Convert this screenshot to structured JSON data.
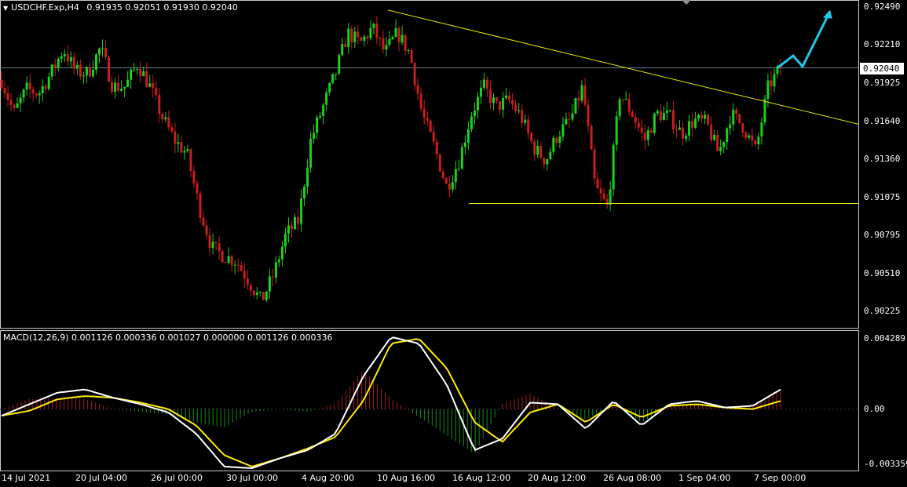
{
  "header": {
    "symbol_label": "USDCHF.Exp,H4",
    "ohlc": "0.91935 0.92051 0.91930 0.92040"
  },
  "macd": {
    "label": "MACD(12,26,9) 0.001126 0.000336 0.001027 0.000000 0.001126 0.000336",
    "ticks": [
      "0.004289",
      "0.00",
      "-0.003359"
    ]
  },
  "price_axis": {
    "ticks": [
      "0.92490",
      "0.92210",
      "0.91925",
      "0.91640",
      "0.91360",
      "0.91075",
      "0.90795",
      "0.90510",
      "0.90225"
    ],
    "current": "0.92040"
  },
  "time_axis": {
    "ticks": [
      "14 Jul 2021",
      "20 Jul 04:00",
      "26 Jul 00:00",
      "30 Jul 00:00",
      "4 Aug 20:00",
      "10 Aug 16:00",
      "16 Aug 12:00",
      "20 Aug 12:00",
      "26 Aug 08:00",
      "1 Sep 04:00",
      "7 Sep 00:00"
    ]
  },
  "colors": {
    "bull": "#1bd11b",
    "bear": "#c81e1e",
    "trendline": "#e6e600",
    "macd_line": "#ffffff",
    "signal_line": "#ffee00",
    "arrow": "#1ec8e6",
    "grid_line": "#6e7e8c"
  },
  "chart_data": {
    "type": "candlestick",
    "symbol": "USDCHF.Exp",
    "timeframe": "H4",
    "ylim": [
      0.9014,
      0.9251
    ],
    "current_price": 0.9204,
    "waypoints": [
      0.9195,
      0.917,
      0.9188,
      0.9185,
      0.92,
      0.9218,
      0.9201,
      0.92,
      0.9219,
      0.919,
      0.919,
      0.9207,
      0.919,
      0.9167,
      0.915,
      0.914,
      0.91,
      0.907,
      0.9064,
      0.906,
      0.9045,
      0.903,
      0.905,
      0.908,
      0.909,
      0.915,
      0.9175,
      0.92,
      0.923,
      0.9222,
      0.9234,
      0.9215,
      0.923,
      0.9215,
      0.917,
      0.9145,
      0.9115,
      0.9135,
      0.917,
      0.919,
      0.9175,
      0.918,
      0.9168,
      0.9145,
      0.9135,
      0.9155,
      0.9165,
      0.919,
      0.9115,
      0.91,
      0.9185,
      0.917,
      0.915,
      0.917,
      0.9168,
      0.9155,
      0.9165,
      0.9163,
      0.914,
      0.917,
      0.916,
      0.9142,
      0.919,
      0.9204
    ],
    "trendline_upper": {
      "from": {
        "x": "10 Aug 16:00",
        "y": 0.9247
      },
      "to": {
        "x": "end",
        "y": 0.9162
      }
    },
    "trendline_lower": {
      "from": {
        "x": "16 Aug 12:00",
        "y": 0.9103
      },
      "to": {
        "x": "end",
        "y": 0.9103
      }
    },
    "projection": [
      0.9204,
      0.9213,
      0.9205,
      0.9246
    ],
    "macd": {
      "ylim": [
        -0.003359,
        0.004289
      ],
      "macd_waypoints": [
        -0.0004,
        0.0003,
        0.001,
        0.0012,
        0.0007,
        0.0003,
        -0.0002,
        -0.0015,
        -0.0035,
        -0.0036,
        -0.003,
        -0.0025,
        -0.0015,
        0.002,
        0.0044,
        0.004,
        0.0015,
        -0.0025,
        -0.0018,
        0.0004,
        0.0003,
        -0.0012,
        0.0005,
        -0.001,
        0.0003,
        0.0005,
        0.0001,
        0.0002,
        0.0012
      ],
      "signal_waypoints": [
        -0.0004,
        -0.0001,
        0.0006,
        0.0008,
        0.0007,
        0.0004,
        0.0,
        -0.001,
        -0.0028,
        -0.0035,
        -0.003,
        -0.0024,
        -0.0017,
        0.0005,
        0.004,
        0.0043,
        0.0025,
        -0.0008,
        -0.002,
        -0.0002,
        0.0003,
        -0.0008,
        0.0003,
        -0.0005,
        0.0002,
        0.0003,
        0.0001,
        0.0,
        0.0005
      ]
    }
  }
}
